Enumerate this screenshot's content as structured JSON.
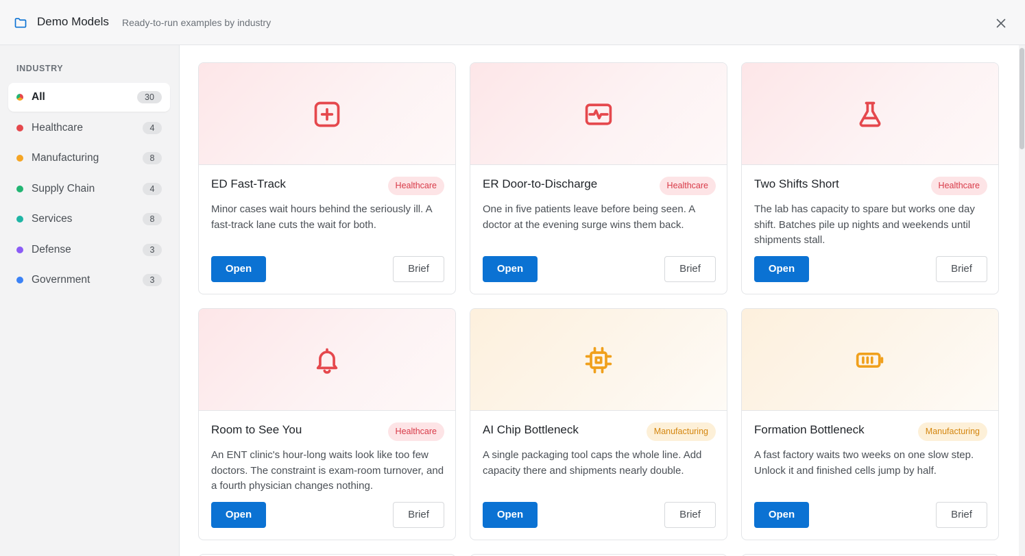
{
  "header": {
    "title": "Demo Models",
    "subtitle": "Ready-to-run examples by industry",
    "folder_icon": "folder-icon",
    "close_icon": "close-icon"
  },
  "sidebar": {
    "section_label": "INDUSTRY",
    "items": [
      {
        "label": "All",
        "count": "30",
        "color": "multi",
        "active": true
      },
      {
        "label": "Healthcare",
        "count": "4",
        "color": "#e5484d"
      },
      {
        "label": "Manufacturing",
        "count": "8",
        "color": "#f5a524"
      },
      {
        "label": "Supply Chain",
        "count": "4",
        "color": "#22b573"
      },
      {
        "label": "Services",
        "count": "8",
        "color": "#1fb5a5"
      },
      {
        "label": "Defense",
        "count": "3",
        "color": "#8b5cf6"
      },
      {
        "label": "Government",
        "count": "3",
        "color": "#3b82f6"
      }
    ]
  },
  "cards": [
    {
      "title": "ED Fast-Track",
      "tag": "Healthcare",
      "icon": "medical-plus-icon",
      "description": "Minor cases wait hours behind the seriously ill. A fast-track lane cuts the wait for both.",
      "open_label": "Open",
      "brief_label": "Brief"
    },
    {
      "title": "ER Door-to-Discharge",
      "tag": "Healthcare",
      "icon": "heart-monitor-icon",
      "description": "One in five patients leave before being seen. A doctor at the evening surge wins them back.",
      "open_label": "Open",
      "brief_label": "Brief"
    },
    {
      "title": "Two Shifts Short",
      "tag": "Healthcare",
      "icon": "flask-icon",
      "description": "The lab has capacity to spare but works one day shift. Batches pile up nights and weekends until shipments stall.",
      "open_label": "Open",
      "brief_label": "Brief"
    },
    {
      "title": "Room to See You",
      "tag": "Healthcare",
      "icon": "bell-icon",
      "description": "An ENT clinic's hour-long waits look like too few doctors. The constraint is exam-room turnover, and a fourth physician changes nothing.",
      "open_label": "Open",
      "brief_label": "Brief"
    },
    {
      "title": "AI Chip Bottleneck",
      "tag": "Manufacturing",
      "icon": "chip-icon",
      "description": "A single packaging tool caps the whole line. Add capacity there and shipments nearly double.",
      "open_label": "Open",
      "brief_label": "Brief"
    },
    {
      "title": "Formation Bottleneck",
      "tag": "Manufacturing",
      "icon": "battery-icon",
      "description": "A fast factory waits two weeks on one slow step. Unlock it and finished cells jump by half.",
      "open_label": "Open",
      "brief_label": "Brief"
    }
  ],
  "colors": {
    "primary": "#0b72d3",
    "healthcare": "#e5484d",
    "manufacturing": "#f5a524"
  }
}
